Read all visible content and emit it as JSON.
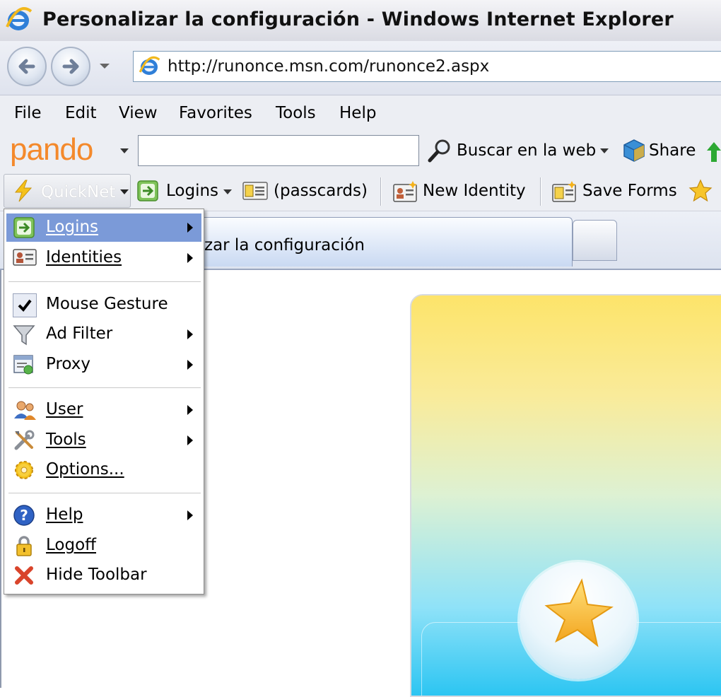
{
  "window": {
    "title": "Personalizar la configuración - Windows Internet Explorer"
  },
  "address_bar": {
    "url": "http://runonce.msn.com/runonce2.aspx"
  },
  "menu_bar": {
    "items": [
      "File",
      "Edit",
      "View",
      "Favorites",
      "Tools",
      "Help"
    ]
  },
  "pando_bar": {
    "logo": "pando",
    "search_value": "",
    "search_button": "Buscar en la web",
    "share_button": "Share"
  },
  "quicknet_bar": {
    "quicknet": "QuickNet",
    "logins": "Logins",
    "passcards": "(passcards)",
    "new_identity": "New Identity",
    "save_forms": "Save Forms"
  },
  "tabs": {
    "active_tab": "zar la configuración"
  },
  "dropdown": {
    "items": [
      {
        "label": "Logins",
        "icon": "logins-arrow-icon",
        "submenu": true,
        "highlighted": true
      },
      {
        "label": "Identities",
        "icon": "identity-card-icon",
        "submenu": true
      },
      {
        "label": "Mouse Gesture",
        "icon": "checkmark-icon",
        "submenu": false
      },
      {
        "label": "Ad Filter",
        "icon": "funnel-icon",
        "submenu": true
      },
      {
        "label": "Proxy",
        "icon": "proxy-icon",
        "submenu": true
      },
      {
        "label": "User",
        "icon": "users-icon",
        "submenu": true
      },
      {
        "label": "Tools",
        "icon": "tools-icon",
        "submenu": true
      },
      {
        "label": "Options...",
        "icon": "gear-icon",
        "submenu": false
      },
      {
        "label": "Help",
        "icon": "help-icon",
        "submenu": true
      },
      {
        "label": "Logoff",
        "icon": "lock-icon",
        "submenu": false
      },
      {
        "label": "Hide Toolbar",
        "icon": "close-x-icon",
        "submenu": false
      }
    ]
  },
  "colors": {
    "menu_highlight": "#7b9ad8",
    "pando_orange": "#f4892b",
    "panel_top": "#fde46a",
    "panel_bottom": "#2cc5f2"
  }
}
